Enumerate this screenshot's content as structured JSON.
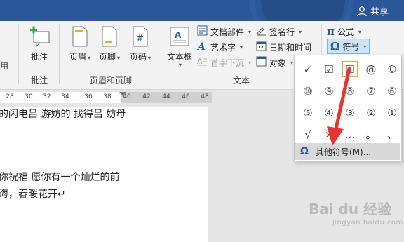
{
  "titlebar": {
    "share_label": "共享"
  },
  "ribbon": {
    "partial_left_label": "用",
    "groups": {
      "comment": {
        "label": "批注",
        "button": "批注"
      },
      "header_footer": {
        "label": "页眉和页脚",
        "header": "页眉",
        "footer": "页脚",
        "page_number": "页码"
      },
      "text": {
        "label": "文本",
        "textbox": "文本框",
        "doc_parts": "文档部件",
        "wordart": "艺术字",
        "dropcap": "首字下沉",
        "signature": "签名行",
        "datetime": "日期和时间",
        "object": "对象"
      },
      "symbols": {
        "equation": "公式",
        "symbol": "符号"
      }
    }
  },
  "ruler": {
    "ticks": [
      "28",
      "30",
      "32",
      "34",
      "36",
      "38",
      "40",
      "42",
      "44",
      "46",
      "48"
    ]
  },
  "document": {
    "lines": [
      "的闪电吕 游妨的 找得吕 妨母",
      "你祝福 愿你有一个灿烂的前",
      "海，春暖花开↵"
    ]
  },
  "symbols_menu": {
    "grid": [
      [
        "✓",
        "☑",
        "☐",
        "@",
        "©"
      ],
      [
        "⑩",
        "⑨",
        "⑧",
        "⑦",
        "⑥"
      ],
      [
        "⑤",
        "④",
        "③",
        "②",
        "①"
      ],
      [
        "√",
        "×",
        "…",
        "。",
        "、"
      ]
    ],
    "more_label": "其他符号(M)..."
  },
  "watermark": {
    "text": "Bai du 经验",
    "sub": "jingyan.baidu.com"
  },
  "colors": {
    "titlebar": "#2b579a",
    "accent": "#2b579a",
    "arrow": "#e8332f"
  }
}
